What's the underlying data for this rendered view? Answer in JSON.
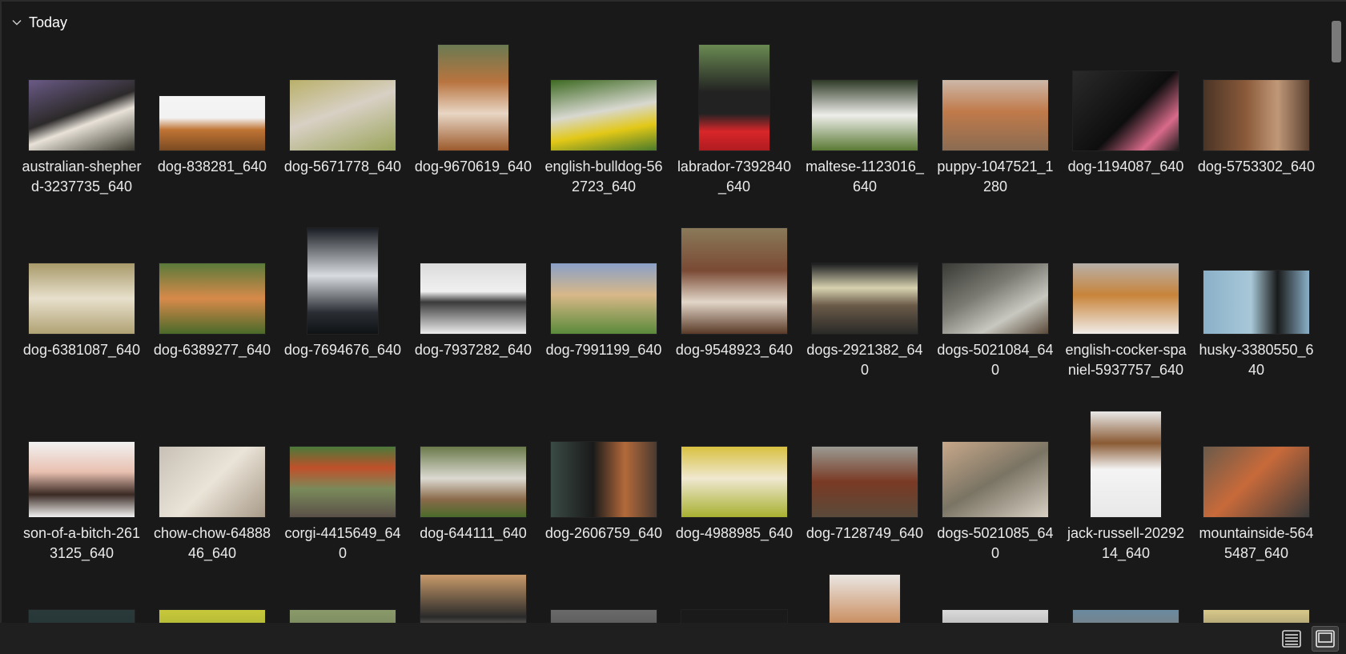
{
  "group": {
    "title": "Today",
    "icon": "chevron-down-icon"
  },
  "items": [
    {
      "name": "australian-shepherd-3237735_640",
      "w": 132,
      "h": 88,
      "bg": "linear-gradient(160deg,#6a5a86 0%,#2c2a2a 45%,#e8e2d8 60%,#3b3a2e 100%)"
    },
    {
      "name": "dog-838281_640",
      "w": 132,
      "h": 68,
      "bg": "linear-gradient(180deg,#f4f4f4 0%,#f2f2f2 40%,#c07434 62%,#7a4a22 100%)"
    },
    {
      "name": "dog-5671778_640",
      "w": 132,
      "h": 88,
      "bg": "linear-gradient(160deg,#b9b06a 0%,#d8d0c4 45%,#9aa45a 100%)"
    },
    {
      "name": "dog-9670619_640",
      "w": 88,
      "h": 132,
      "bg": "linear-gradient(180deg,#6b7a52 0%,#b8743f 35%,#e8d6c4 65%,#9c5a2c 100%)"
    },
    {
      "name": "english-bulldog-562723_640",
      "w": 132,
      "h": 88,
      "bg": "linear-gradient(170deg,#3e6a22 0%,#d8d8d0 45%,#e2c817 70%,#4a7a2a 100%)"
    },
    {
      "name": "labrador-7392840_640",
      "w": 88,
      "h": 132,
      "bg": "linear-gradient(180deg,#6a8a52 0%,#222 45%,#222 65%,#d8262a 82%,#b01c20 100%)"
    },
    {
      "name": "maltese-1123016_640",
      "w": 132,
      "h": 88,
      "bg": "linear-gradient(180deg,#2e3a26 0%,#eeeeea 50%,#5a7a34 100%)"
    },
    {
      "name": "puppy-1047521_1280",
      "w": 132,
      "h": 88,
      "bg": "linear-gradient(180deg,#cdb8a8 0%,#c07a4a 45%,#8a6c52 100%)"
    },
    {
      "name": "dog-1194087_640",
      "w": 132,
      "h": 99,
      "bg": "linear-gradient(135deg,#2a2a2a 0%,#0e0e0e 55%,#d86a8a 80%,#1a1a1a 100%)"
    },
    {
      "name": "dog-5753302_640",
      "w": 132,
      "h": 88,
      "bg": "linear-gradient(90deg,#4a3426 0%,#8a5a3a 40%,#c09878 70%,#5a4030 100%)"
    },
    {
      "name": "dog-6381087_640",
      "w": 132,
      "h": 88,
      "bg": "linear-gradient(180deg,#a89a6a 0%,#e8e0cc 50%,#b0a274 100%)"
    },
    {
      "name": "dog-6389277_640",
      "w": 132,
      "h": 88,
      "bg": "linear-gradient(180deg,#5a7a3a 0%,#d88a4a 50%,#4a6a2a 100%)"
    },
    {
      "name": "dog-7694676_640",
      "w": 88,
      "h": 132,
      "bg": "linear-gradient(180deg,#1a1e24 0%,#d8dce0 45%,#2a2e34 80%,#101214 100%)"
    },
    {
      "name": "dog-7937282_640",
      "w": 132,
      "h": 88,
      "bg": "linear-gradient(180deg,#dcdcdc 0%,#f0f0f0 40%,#3a3a3a 55%,#ececec 100%)"
    },
    {
      "name": "dog-7991199_640",
      "w": 132,
      "h": 88,
      "bg": "linear-gradient(180deg,#8aa0c8 0%,#d8b888 45%,#5a8a3a 100%)"
    },
    {
      "name": "dog-9548923_640",
      "w": 132,
      "h": 132,
      "bg": "linear-gradient(180deg,#8a7a5a 0%,#7a4a34 40%,#e2d6c8 70%,#5a3a28 100%)"
    },
    {
      "name": "dogs-2921382_640",
      "w": 132,
      "h": 88,
      "bg": "linear-gradient(180deg,#1a1c1e 0%,#d8d2b0 35%,#6a5a48 60%,#2a2a28 100%)"
    },
    {
      "name": "dogs-5021084_640",
      "w": 132,
      "h": 88,
      "bg": "linear-gradient(150deg,#3a3a36 0%,#7a7a72 40%,#c8c8c0 70%,#5a4a3a 100%)"
    },
    {
      "name": "english-cocker-spaniel-5937757_640",
      "w": 132,
      "h": 88,
      "bg": "linear-gradient(180deg,#b8b0a8 0%,#c8843a 45%,#f0ece8 100%)"
    },
    {
      "name": "husky-3380550_640",
      "w": 132,
      "h": 79,
      "bg": "linear-gradient(90deg,#8ab0c8 0%,#a8c8d8 45%,#1a1a1a 70%,#8ab0c8 100%)"
    },
    {
      "name": "son-of-a-bitch-2613125_640",
      "w": 132,
      "h": 94,
      "bg": "linear-gradient(180deg,#f2f2f2 0%,#e8c0b0 40%,#3a2a24 70%,#f2f2f2 100%)"
    },
    {
      "name": "chow-chow-6488846_640",
      "w": 132,
      "h": 88,
      "bg": "linear-gradient(135deg,#c8c0b4 0%,#eae4d8 50%,#a89a88 100%)"
    },
    {
      "name": "corgi-4415649_640",
      "w": 132,
      "h": 88,
      "bg": "linear-gradient(180deg,#4a7a3a 0%,#c0502a 30%,#7a8a5a 60%,#5a5048 100%)"
    },
    {
      "name": "dog-644111_640",
      "w": 132,
      "h": 88,
      "bg": "linear-gradient(180deg,#6a7a4a 0%,#dcdad2 45%,#8a6a4a 75%,#4a6a2a 100%)"
    },
    {
      "name": "dog-2606759_640",
      "w": 132,
      "h": 94,
      "bg": "linear-gradient(90deg,#3a4a44 0%,#1a1a1a 40%,#b46a3a 70%,#4a3a30 100%)"
    },
    {
      "name": "dog-4988985_640",
      "w": 132,
      "h": 88,
      "bg": "linear-gradient(180deg,#d8c040 0%,#f0e8d0 45%,#a8b030 100%)"
    },
    {
      "name": "dog-7128749_640",
      "w": 132,
      "h": 88,
      "bg": "linear-gradient(180deg,#9a9a92 0%,#7a3a24 50%,#5a4a3a 100%)"
    },
    {
      "name": "dogs-5021085_640",
      "w": 132,
      "h": 94,
      "bg": "linear-gradient(150deg,#c8a88a 0%,#7a7464 50%,#d8d0c4 100%)"
    },
    {
      "name": "jack-russell-2029214_640",
      "w": 88,
      "h": 132,
      "bg": "linear-gradient(180deg,#e8e8e8 0%,#8a5a34 30%,#f4f4f4 55%,#e8e8e8 100%)"
    },
    {
      "name": "mountainside-5645487_640",
      "w": 132,
      "h": 88,
      "bg": "linear-gradient(135deg,#6a5a4a 0%,#c86a3a 45%,#3a3a3a 100%)"
    },
    {
      "name": "",
      "w": 132,
      "h": 88,
      "bg": "linear-gradient(180deg,#2a3a3a 0%,#1a2a2a 100%)"
    },
    {
      "name": "",
      "w": 132,
      "h": 88,
      "bg": "linear-gradient(180deg,#c8c83a 0%,#6a8a2a 100%)"
    },
    {
      "name": "",
      "w": 132,
      "h": 88,
      "bg": "linear-gradient(180deg,#8a9a6a 0%,#4a5a3a 100%)"
    },
    {
      "name": "",
      "w": 132,
      "h": 132,
      "bg": "linear-gradient(180deg,#c89a6a 0%,#2a2a2a 40%,#f0e8e0 70%,#2a2a2a 100%)"
    },
    {
      "name": "",
      "w": 132,
      "h": 88,
      "bg": "linear-gradient(180deg,#6a6a6a 0%,#2a2a2a 100%)"
    },
    {
      "name": "",
      "w": 132,
      "h": 88,
      "bg": "linear-gradient(180deg,#1a1a1a 0%,#1a1a1a 100%)"
    },
    {
      "name": "",
      "w": 88,
      "h": 132,
      "bg": "linear-gradient(180deg,#eae6e2 0%,#c0743a 60%,#eae6e2 100%)"
    },
    {
      "name": "",
      "w": 132,
      "h": 88,
      "bg": "linear-gradient(180deg,#dadada 0%,#5a5a5a 100%)"
    },
    {
      "name": "",
      "w": 132,
      "h": 88,
      "bg": "linear-gradient(180deg,#6a8aa0 0%,#a06a3a 100%)"
    },
    {
      "name": "",
      "w": 132,
      "h": 88,
      "bg": "linear-gradient(180deg,#d8c88a 0%,#2a2a2a 100%)"
    }
  ],
  "view_buttons": [
    {
      "name": "details-view",
      "icon": "list-view-icon",
      "active": false
    },
    {
      "name": "large-icons-view",
      "icon": "thumbnail-view-icon",
      "active": true
    }
  ]
}
